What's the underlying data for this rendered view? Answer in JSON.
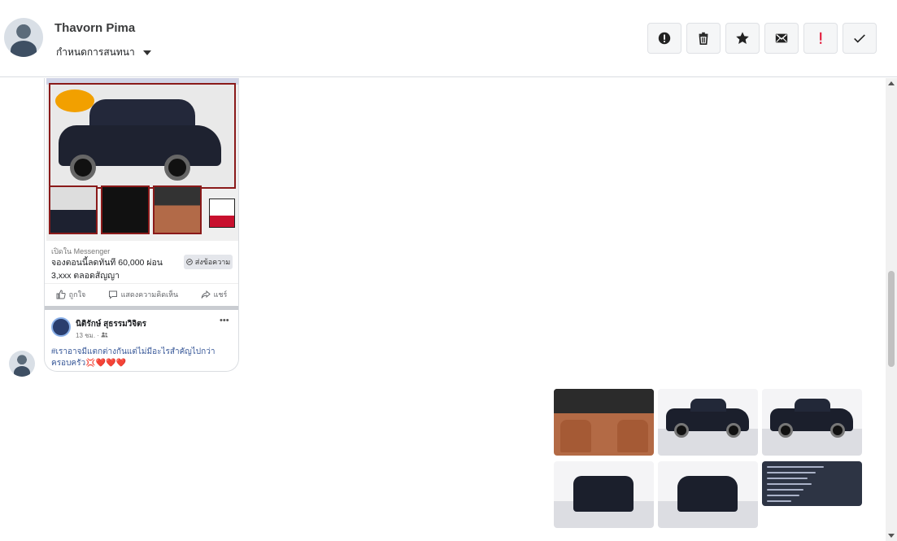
{
  "header": {
    "contact_name": "Thavorn Pima",
    "action_label": "กำหนดการสนทนา",
    "toolbar": [
      {
        "name": "mark-spam-button",
        "icon": "alert-circle-icon"
      },
      {
        "name": "delete-button",
        "icon": "trash-icon"
      },
      {
        "name": "star-button",
        "icon": "star-icon"
      },
      {
        "name": "mark-unread-button",
        "icon": "envelope-icon"
      },
      {
        "name": "follow-up-button",
        "icon": "exclamation-icon"
      },
      {
        "name": "mark-done-button",
        "icon": "checkmark-icon"
      }
    ]
  },
  "shared_post": {
    "meta": "เปิดใน Messenger",
    "ad_text": "จองตอนนี้ลดทันที 60,000 ผ่อน 3,xxx ตลอดสัญญา",
    "send_label": "ส่งข้อความ",
    "actions": [
      "ถูกใจ",
      "แสดงความคิดเห็น",
      "แชร์"
    ],
    "author": "นิติรักษ์ สุธรรมวิจิตร",
    "time": "13 ชม. ·",
    "text": "#เราอาจมีแตกต่างกันแต่ไม่มีอะไรสำคัญไปกว่าครอบครัว💢❤️❤️❤️"
  },
  "photos": [
    {
      "name": "photo-interior",
      "kind": "interior"
    },
    {
      "name": "photo-side-left",
      "kind": "side"
    },
    {
      "name": "photo-side-right",
      "kind": "side"
    },
    {
      "name": "photo-rear",
      "kind": "rear"
    },
    {
      "name": "photo-front",
      "kind": "front"
    },
    {
      "name": "photo-spec-sheet",
      "kind": "spec"
    }
  ],
  "colors": {
    "accent_red": "#e41e3f",
    "link": "#385898",
    "ad_frame": "#8a1a1a"
  }
}
